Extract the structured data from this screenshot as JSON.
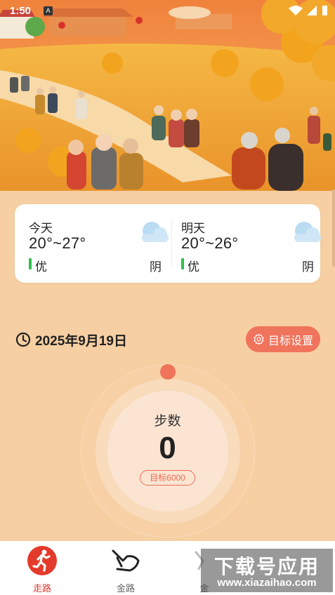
{
  "status_bar": {
    "time": "1:50",
    "indicator": "A"
  },
  "hero": {
    "description_icon": "golden-ginkgo-illustration-icon"
  },
  "weather": {
    "today": {
      "day": "今天",
      "temp": "20°~27°",
      "aqi": "优",
      "condition": "阴"
    },
    "tomorrow": {
      "day": "明天",
      "temp": "20°~26°",
      "aqi": "优",
      "condition": "阴"
    }
  },
  "date": {
    "text": "2025年9月19日"
  },
  "goal_button": {
    "label": "目标设置"
  },
  "steps": {
    "label": "步数",
    "count": "0",
    "target": "目标6000",
    "progress": 0
  },
  "nav": {
    "items": [
      {
        "label": "走路",
        "icon": "runner-icon",
        "active": true
      },
      {
        "label": "金路",
        "icon": "gold-hand-icon",
        "active": false
      },
      {
        "label": "金",
        "icon": "gold-icon",
        "active": false
      }
    ]
  },
  "watermark": {
    "title": "下载号应用",
    "url": "www.xiazaihao.com"
  },
  "colors": {
    "accent": "#f0735b",
    "background": "#f6cfa2",
    "nav_active": "#e43a2b",
    "aqi_good": "#2fbf4b"
  }
}
